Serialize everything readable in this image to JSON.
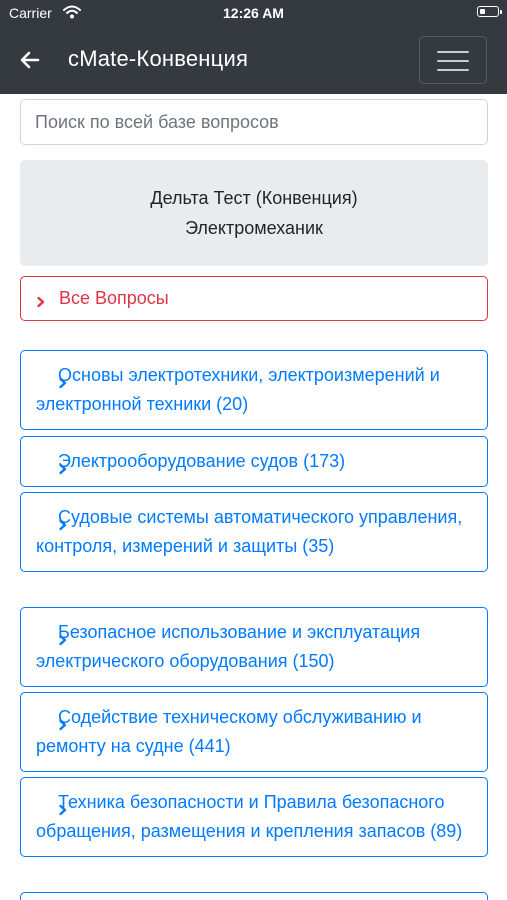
{
  "status_bar": {
    "carrier": "Carrier",
    "time": "12:26 AM"
  },
  "navbar": {
    "title": "cMate-Конвенция"
  },
  "search": {
    "placeholder": "Поиск по всей базе вопросов",
    "value": ""
  },
  "info": {
    "line1": "Дельта Тест (Конвенция)",
    "line2": "Электромеханик"
  },
  "all_questions": {
    "label": "Все Вопросы"
  },
  "categories": [
    {
      "label": "Основы электротехники, электроизмерений и электронной техники (20)"
    },
    {
      "label": "Электрооборудование судов (173)"
    },
    {
      "label": "Судовые системы автоматического управления, контроля, измерений и защиты (35)"
    },
    {
      "label": "Безопасное использование и эксплуатация электрического оборудования (150)"
    },
    {
      "label": "Содействие техническому обслуживанию и ремонту на судне (441)"
    },
    {
      "label": "Техника безопасности и Правила безопасного обращения, размещения и крепления запасов (89)"
    }
  ],
  "colors": {
    "navbar": "#343a40",
    "link": "#007bff",
    "danger": "#dc3545",
    "info_bg": "#e9ecef"
  }
}
